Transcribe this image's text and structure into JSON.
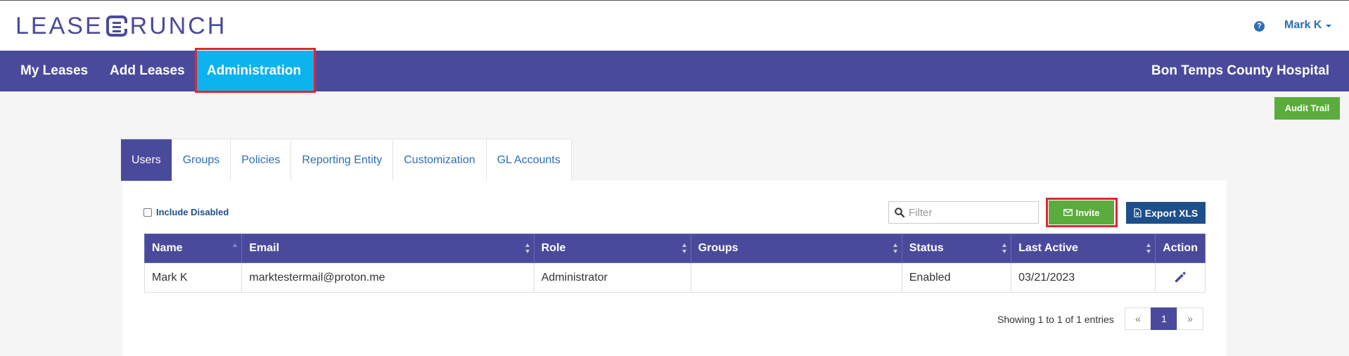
{
  "header": {
    "logo_left": "LEASE",
    "logo_right": "RUNCH",
    "help_icon": "?",
    "user_name": "Mark K"
  },
  "nav": {
    "items": [
      {
        "label": "My Leases"
      },
      {
        "label": "Add Leases"
      },
      {
        "label": "Administration",
        "active": true
      }
    ],
    "organization": "Bon Temps County Hospital"
  },
  "toolbar": {
    "audit_label": "Audit Trail"
  },
  "tabs": [
    {
      "label": "Users",
      "active": true
    },
    {
      "label": "Groups"
    },
    {
      "label": "Policies"
    },
    {
      "label": "Reporting Entity"
    },
    {
      "label": "Customization"
    },
    {
      "label": "GL Accounts"
    }
  ],
  "users": {
    "include_disabled_label": "Include Disabled",
    "include_disabled_checked": false,
    "filter_placeholder": "Filter",
    "invite_label": "Invite",
    "export_label": "Export XLS",
    "columns": [
      "Name",
      "Email",
      "Role",
      "Groups",
      "Status",
      "Last Active",
      "Action"
    ],
    "rows": [
      {
        "name": "Mark K",
        "email": "marktestermail@proton.me",
        "role": "Administrator",
        "groups": "",
        "status": "Enabled",
        "last_active": "03/21/2023",
        "action_icon": "pencil-icon"
      }
    ],
    "pagination": {
      "info": "Showing 1 to 1 of 1 entries",
      "prev": "«",
      "current": "1",
      "next": "»"
    }
  },
  "colors": {
    "brand": "#4a4a9c",
    "active_nav": "#0db3ec",
    "success": "#5aac3d",
    "export": "#1d4f8a",
    "highlight": "#e3262d"
  }
}
